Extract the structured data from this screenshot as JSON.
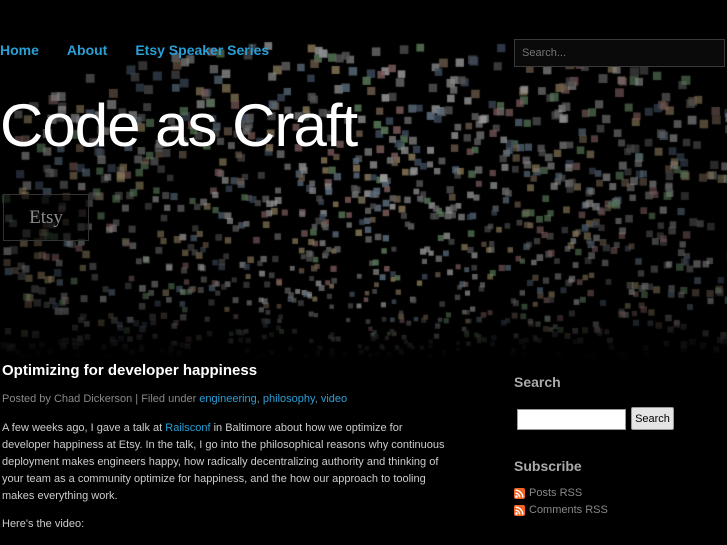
{
  "nav": {
    "items": [
      {
        "label": "Home"
      },
      {
        "label": "About"
      },
      {
        "label": "Etsy Speaker Series"
      }
    ]
  },
  "header": {
    "search_placeholder": "Search...",
    "site_title": "Code as Craft",
    "logo_text": "Etsy"
  },
  "post": {
    "title": "Optimizing for developer happiness",
    "meta_prefix": "Posted by Chad Dickerson | Filed under ",
    "categories": [
      "engineering",
      "philosophy",
      "video"
    ],
    "body_p1_a": "A few weeks ago, I gave a talk at ",
    "body_p1_link": "Railsconf",
    "body_p1_b": " in Baltimore about how we optimize for developer happiness at Etsy. In the talk, I go into the philosophical reasons why continuous deployment makes engineers happy, how radically decentralizing authority and thinking of your team as a community optimize for happiness, and the how our approach to tooling makes everything work.",
    "body_p2": "Here's the video:"
  },
  "sidebar": {
    "search_heading": "Search",
    "search_button": "Search",
    "subscribe_heading": "Subscribe",
    "feeds": [
      {
        "label": "Posts RSS",
        "icon": "rss-icon"
      },
      {
        "label": "Comments RSS",
        "icon": "rss-icon"
      }
    ]
  },
  "colors": {
    "background": "#000000",
    "link": "#2a9fd6",
    "heading": "#ffffff",
    "rss": "#f26522"
  }
}
